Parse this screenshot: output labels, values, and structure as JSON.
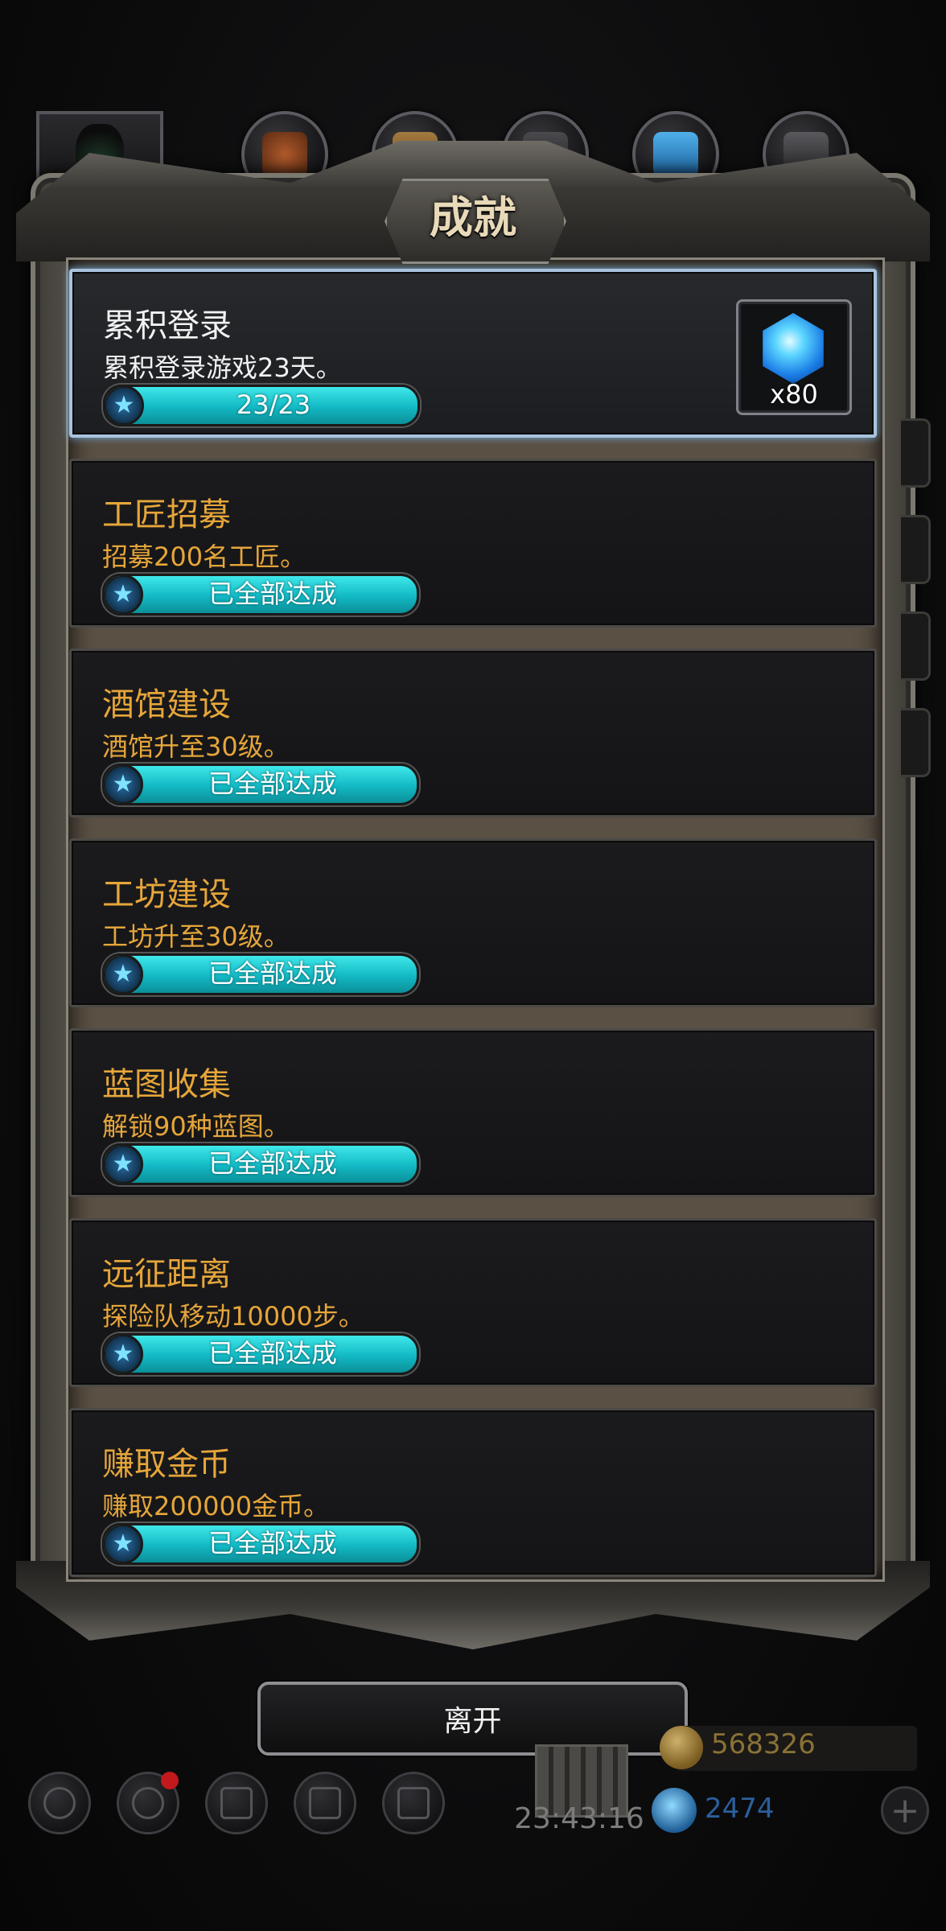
{
  "window": {
    "title": "成就"
  },
  "achievements": [
    {
      "name": "累积登录",
      "desc": "累积登录游戏23天。",
      "progress": "23/23",
      "active": true,
      "reward": {
        "icon": "blue-gem-icon",
        "qty": "x80"
      }
    },
    {
      "name": "工匠招募",
      "desc": "招募200名工匠。",
      "progress": "已全部达成",
      "active": false
    },
    {
      "name": "酒馆建设",
      "desc": "酒馆升至30级。",
      "progress": "已全部达成",
      "active": false
    },
    {
      "name": "工坊建设",
      "desc": "工坊升至30级。",
      "progress": "已全部达成",
      "active": false
    },
    {
      "name": "蓝图收集",
      "desc": "解锁90种蓝图。",
      "progress": "已全部达成",
      "active": false
    },
    {
      "name": "远征距离",
      "desc": "探险队移动10000步。",
      "progress": "已全部达成",
      "active": false
    },
    {
      "name": "赚取金币",
      "desc": "赚取200000金币。",
      "progress": "已全部达成",
      "active": false
    }
  ],
  "leave_button": {
    "label": "离开"
  },
  "hud": {
    "time": "23:43:16",
    "gold": "568326",
    "gems": "2474"
  },
  "colors": {
    "accent": "#e6a63a",
    "bar": "#1fd0d8",
    "highlight": "#a9c3dd"
  }
}
